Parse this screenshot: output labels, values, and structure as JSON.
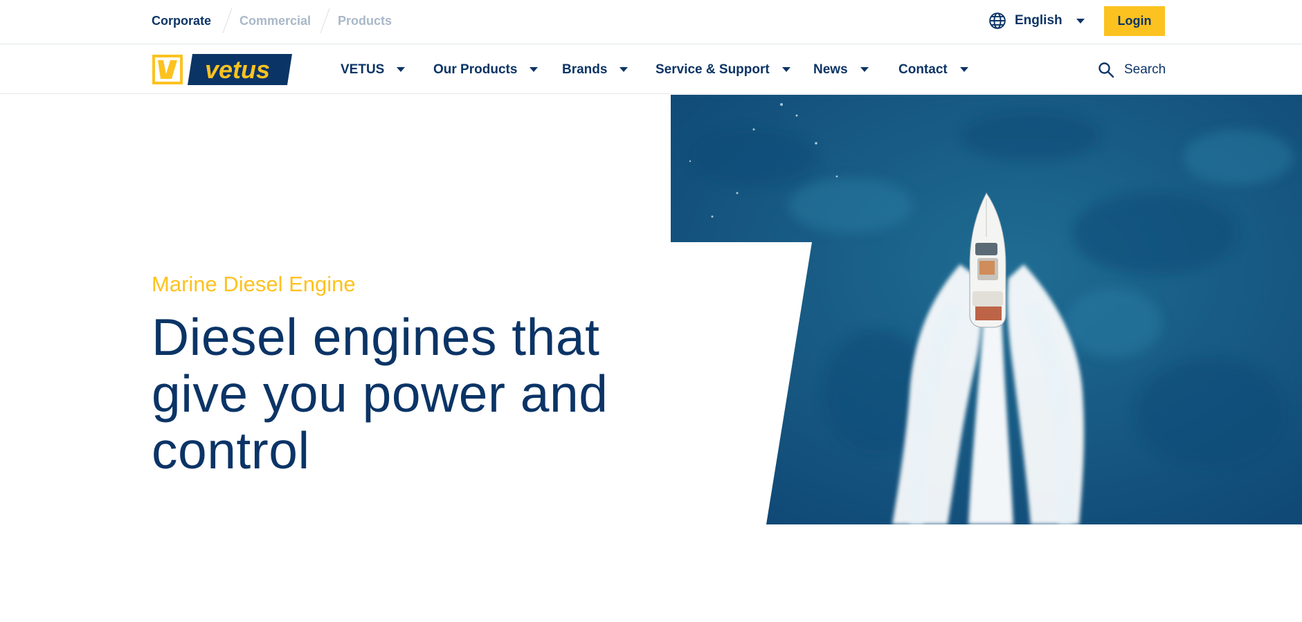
{
  "topbar": {
    "segments": [
      {
        "label": "Corporate",
        "active": true
      },
      {
        "label": "Commercial",
        "active": false
      },
      {
        "label": "Products",
        "active": false
      }
    ],
    "language": {
      "label": "English",
      "icon": "globe-icon"
    },
    "login_label": "Login"
  },
  "nav": {
    "logo_text": "vetus",
    "items": [
      {
        "label": "VETUS"
      },
      {
        "label": "Our Products"
      },
      {
        "label": "Brands"
      },
      {
        "label": "Service & Support"
      },
      {
        "label": "News"
      },
      {
        "label": "Contact"
      }
    ],
    "search_label": "Search",
    "search_icon": "search-icon"
  },
  "hero": {
    "eyebrow": "Marine Diesel Engine",
    "headline": "Diesel engines that give you power and control",
    "image_subject": "motorboat-aerial-photo"
  },
  "colors": {
    "brand_navy": "#0b3466",
    "brand_yellow": "#fcc21f",
    "muted_text": "#a9b8c8"
  }
}
